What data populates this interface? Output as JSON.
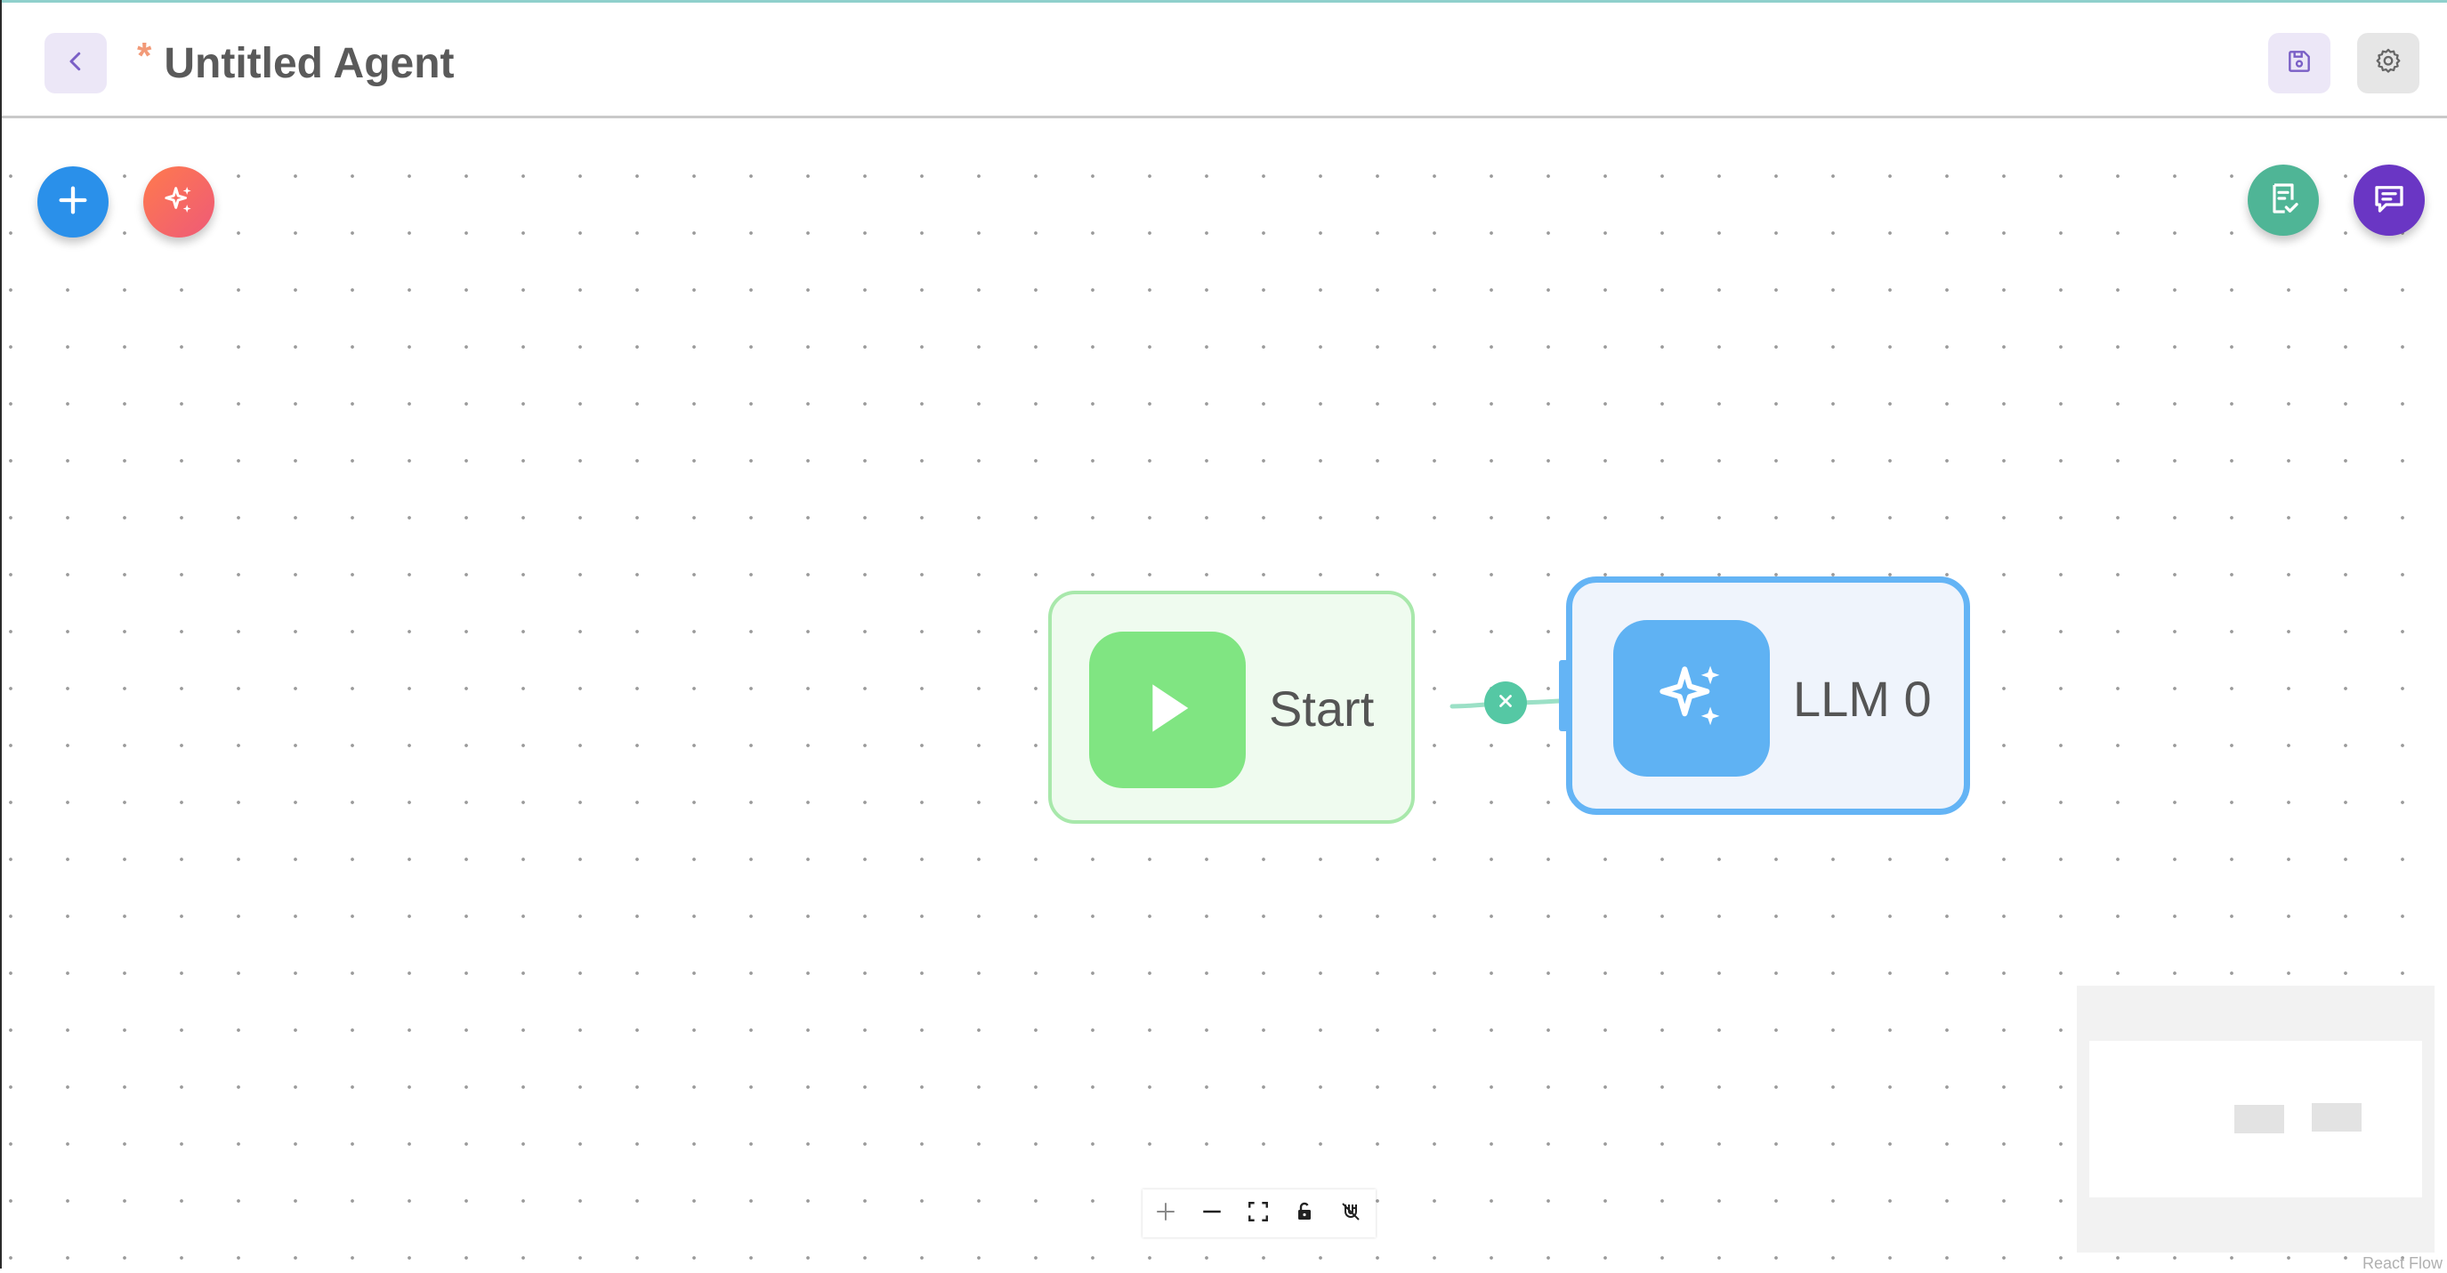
{
  "header": {
    "back_icon": "chevron-left-icon",
    "unsaved_marker": "*",
    "title": "Untitled Agent",
    "save_icon": "floppy-disk-icon",
    "settings_icon": "gear-icon"
  },
  "canvas": {
    "left_actions": [
      {
        "name": "add-node-button",
        "icon": "plus-icon",
        "color": "#2a90ea"
      },
      {
        "name": "ai-magic-button",
        "icon": "sparkles-icon",
        "color": "#ee6a5e"
      }
    ],
    "right_actions": [
      {
        "name": "checklist-button",
        "icon": "clipboard-check-icon",
        "color": "#4fb596"
      },
      {
        "name": "chat-button",
        "icon": "chat-bubble-icon",
        "color": "#6a36c4"
      }
    ],
    "nodes": [
      {
        "label": "Start",
        "icon": "play-icon",
        "color": "#80e582"
      },
      {
        "label": "LLM 0",
        "icon": "sparkles-icon",
        "color": "#5fb2f3",
        "selected": true
      }
    ],
    "edge_delete_icon": "close-icon"
  },
  "controls": [
    {
      "name": "zoom-in-button",
      "icon": "plus-icon"
    },
    {
      "name": "zoom-out-button",
      "icon": "minus-icon"
    },
    {
      "name": "fit-view-button",
      "icon": "fullscreen-icon"
    },
    {
      "name": "lock-button",
      "icon": "unlock-icon"
    },
    {
      "name": "snap-button",
      "icon": "magnet-off-icon"
    }
  ],
  "attribution": "React Flow",
  "colors": {
    "accent_purple_light": "#ece7f7",
    "start_node_bg": "#effbef",
    "llm_node_border": "#64b4f5"
  }
}
